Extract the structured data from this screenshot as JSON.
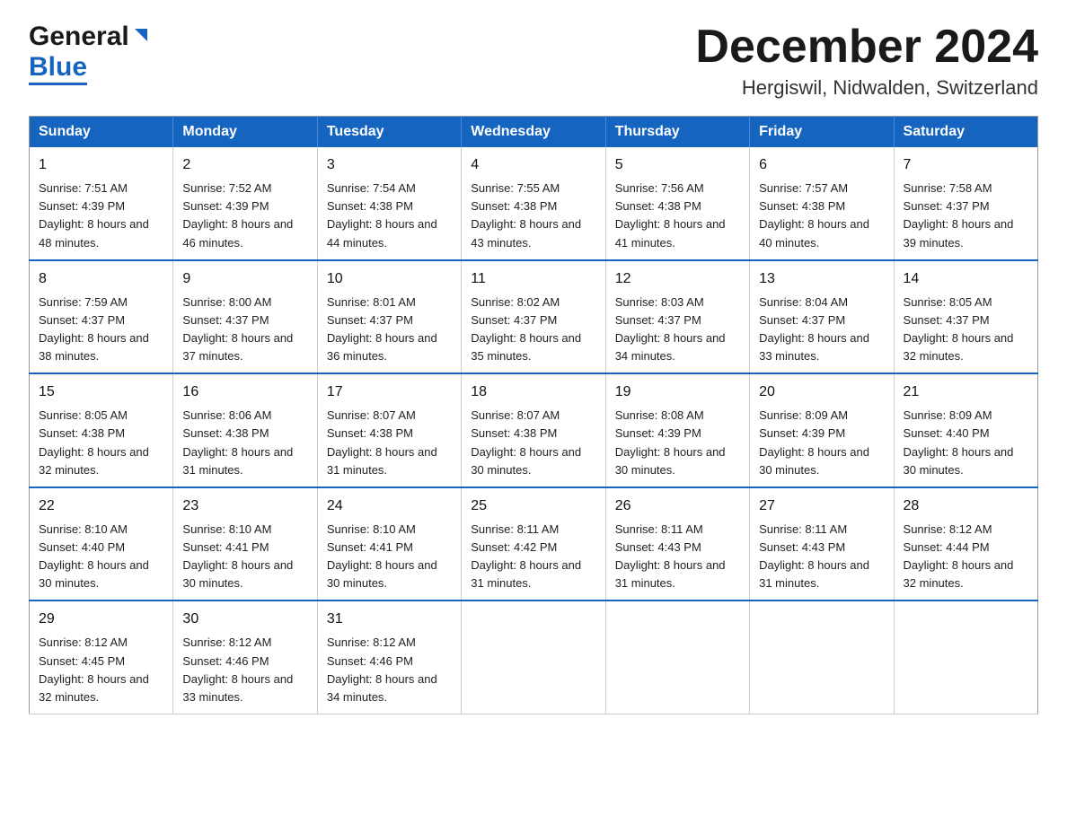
{
  "header": {
    "logo": {
      "line1": "General",
      "line2": "Blue"
    },
    "title": "December 2024",
    "location": "Hergiswil, Nidwalden, Switzerland"
  },
  "calendar": {
    "days_of_week": [
      "Sunday",
      "Monday",
      "Tuesday",
      "Wednesday",
      "Thursday",
      "Friday",
      "Saturday"
    ],
    "weeks": [
      [
        {
          "day": "1",
          "sunrise": "7:51 AM",
          "sunset": "4:39 PM",
          "daylight": "8 hours and 48 minutes."
        },
        {
          "day": "2",
          "sunrise": "7:52 AM",
          "sunset": "4:39 PM",
          "daylight": "8 hours and 46 minutes."
        },
        {
          "day": "3",
          "sunrise": "7:54 AM",
          "sunset": "4:38 PM",
          "daylight": "8 hours and 44 minutes."
        },
        {
          "day": "4",
          "sunrise": "7:55 AM",
          "sunset": "4:38 PM",
          "daylight": "8 hours and 43 minutes."
        },
        {
          "day": "5",
          "sunrise": "7:56 AM",
          "sunset": "4:38 PM",
          "daylight": "8 hours and 41 minutes."
        },
        {
          "day": "6",
          "sunrise": "7:57 AM",
          "sunset": "4:38 PM",
          "daylight": "8 hours and 40 minutes."
        },
        {
          "day": "7",
          "sunrise": "7:58 AM",
          "sunset": "4:37 PM",
          "daylight": "8 hours and 39 minutes."
        }
      ],
      [
        {
          "day": "8",
          "sunrise": "7:59 AM",
          "sunset": "4:37 PM",
          "daylight": "8 hours and 38 minutes."
        },
        {
          "day": "9",
          "sunrise": "8:00 AM",
          "sunset": "4:37 PM",
          "daylight": "8 hours and 37 minutes."
        },
        {
          "day": "10",
          "sunrise": "8:01 AM",
          "sunset": "4:37 PM",
          "daylight": "8 hours and 36 minutes."
        },
        {
          "day": "11",
          "sunrise": "8:02 AM",
          "sunset": "4:37 PM",
          "daylight": "8 hours and 35 minutes."
        },
        {
          "day": "12",
          "sunrise": "8:03 AM",
          "sunset": "4:37 PM",
          "daylight": "8 hours and 34 minutes."
        },
        {
          "day": "13",
          "sunrise": "8:04 AM",
          "sunset": "4:37 PM",
          "daylight": "8 hours and 33 minutes."
        },
        {
          "day": "14",
          "sunrise": "8:05 AM",
          "sunset": "4:37 PM",
          "daylight": "8 hours and 32 minutes."
        }
      ],
      [
        {
          "day": "15",
          "sunrise": "8:05 AM",
          "sunset": "4:38 PM",
          "daylight": "8 hours and 32 minutes."
        },
        {
          "day": "16",
          "sunrise": "8:06 AM",
          "sunset": "4:38 PM",
          "daylight": "8 hours and 31 minutes."
        },
        {
          "day": "17",
          "sunrise": "8:07 AM",
          "sunset": "4:38 PM",
          "daylight": "8 hours and 31 minutes."
        },
        {
          "day": "18",
          "sunrise": "8:07 AM",
          "sunset": "4:38 PM",
          "daylight": "8 hours and 30 minutes."
        },
        {
          "day": "19",
          "sunrise": "8:08 AM",
          "sunset": "4:39 PM",
          "daylight": "8 hours and 30 minutes."
        },
        {
          "day": "20",
          "sunrise": "8:09 AM",
          "sunset": "4:39 PM",
          "daylight": "8 hours and 30 minutes."
        },
        {
          "day": "21",
          "sunrise": "8:09 AM",
          "sunset": "4:40 PM",
          "daylight": "8 hours and 30 minutes."
        }
      ],
      [
        {
          "day": "22",
          "sunrise": "8:10 AM",
          "sunset": "4:40 PM",
          "daylight": "8 hours and 30 minutes."
        },
        {
          "day": "23",
          "sunrise": "8:10 AM",
          "sunset": "4:41 PM",
          "daylight": "8 hours and 30 minutes."
        },
        {
          "day": "24",
          "sunrise": "8:10 AM",
          "sunset": "4:41 PM",
          "daylight": "8 hours and 30 minutes."
        },
        {
          "day": "25",
          "sunrise": "8:11 AM",
          "sunset": "4:42 PM",
          "daylight": "8 hours and 31 minutes."
        },
        {
          "day": "26",
          "sunrise": "8:11 AM",
          "sunset": "4:43 PM",
          "daylight": "8 hours and 31 minutes."
        },
        {
          "day": "27",
          "sunrise": "8:11 AM",
          "sunset": "4:43 PM",
          "daylight": "8 hours and 31 minutes."
        },
        {
          "day": "28",
          "sunrise": "8:12 AM",
          "sunset": "4:44 PM",
          "daylight": "8 hours and 32 minutes."
        }
      ],
      [
        {
          "day": "29",
          "sunrise": "8:12 AM",
          "sunset": "4:45 PM",
          "daylight": "8 hours and 32 minutes."
        },
        {
          "day": "30",
          "sunrise": "8:12 AM",
          "sunset": "4:46 PM",
          "daylight": "8 hours and 33 minutes."
        },
        {
          "day": "31",
          "sunrise": "8:12 AM",
          "sunset": "4:46 PM",
          "daylight": "8 hours and 34 minutes."
        },
        null,
        null,
        null,
        null
      ]
    ]
  }
}
